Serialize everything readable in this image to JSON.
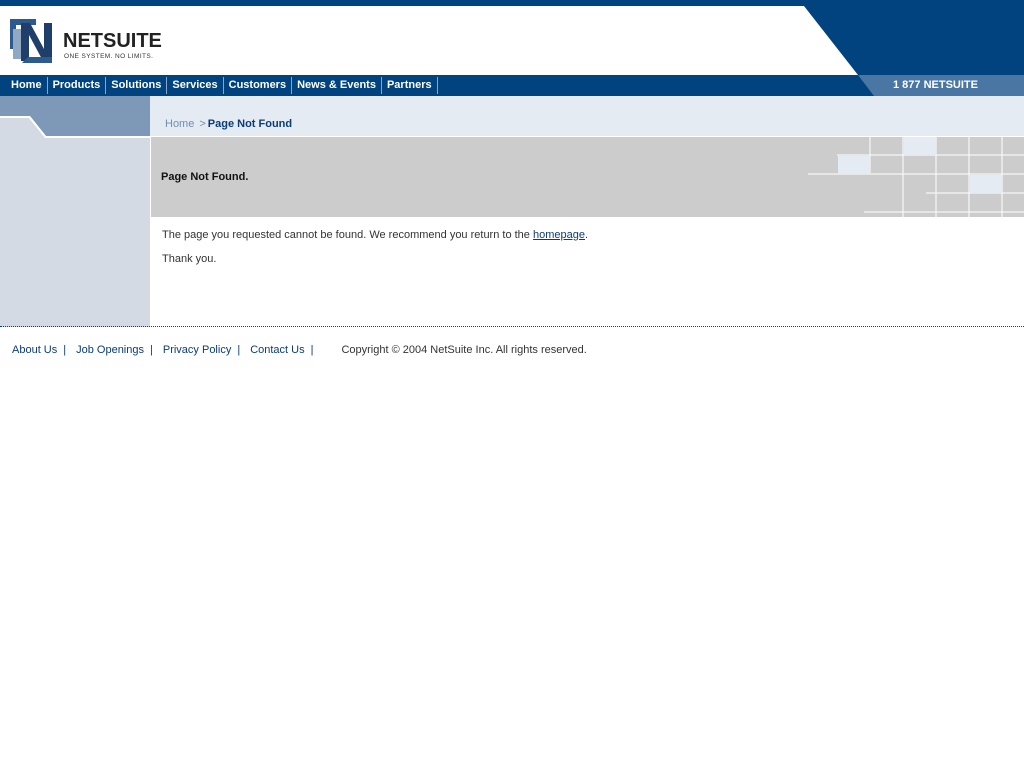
{
  "header": {
    "logo_word_net": "NET",
    "logo_word_suite": "SUITE",
    "logo_tagline": "ONE SYSTEM. NO LIMITS.",
    "phone": "1 877 NETSUITE"
  },
  "nav": {
    "items": [
      "Home",
      "Products",
      "Solutions",
      "Services",
      "Customers",
      "News & Events",
      "Partners"
    ]
  },
  "breadcrumb": {
    "home": "Home",
    "separator": ">",
    "current": "Page Not Found"
  },
  "page": {
    "title": "Page Not Found.",
    "message_before_link": "The page you requested cannot be found. We recommend you return to the ",
    "link_text": "homepage",
    "message_after_link": ".",
    "thanks": "Thank you."
  },
  "footer": {
    "links": [
      "About Us",
      "Job Openings",
      "Privacy Policy",
      "Contact Us"
    ],
    "separator": "|",
    "copyright": "Copyright © 2004 NetSuite Inc. All rights reserved."
  },
  "colors": {
    "brand_blue": "#00437f",
    "phone_band": "#4a76a3",
    "sidebar": "#d3dae4",
    "crumb_band": "#e4ebf3",
    "title_band": "#cccccc"
  }
}
